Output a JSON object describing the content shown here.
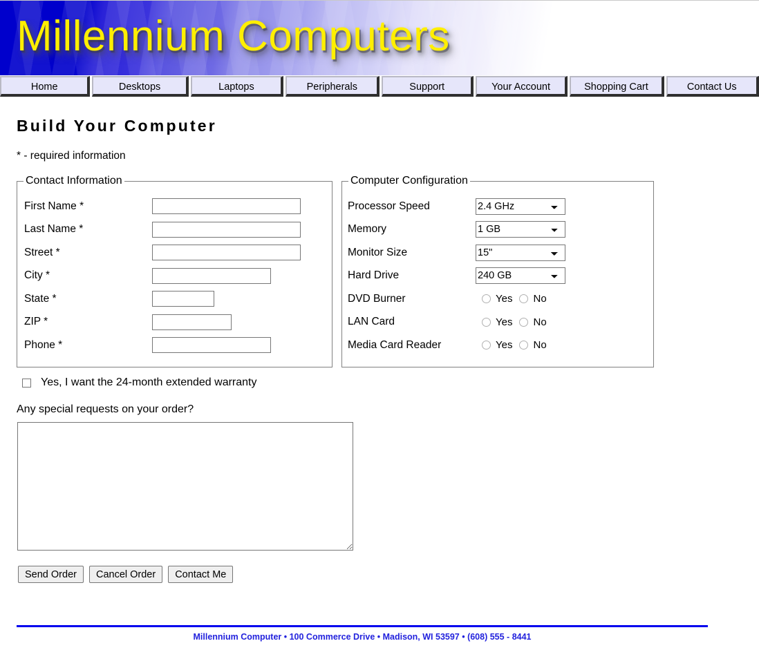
{
  "site": {
    "banner_title": "Millennium Computers"
  },
  "nav": {
    "items": [
      {
        "label": "Home"
      },
      {
        "label": "Desktops"
      },
      {
        "label": "Laptops"
      },
      {
        "label": "Peripherals"
      },
      {
        "label": "Support"
      },
      {
        "label": "Your Account"
      },
      {
        "label": "Shopping Cart"
      },
      {
        "label": "Contact Us"
      }
    ]
  },
  "page": {
    "title": "Build Your Computer",
    "required_note": "* - required information"
  },
  "contact": {
    "legend": "Contact Information",
    "fields": [
      {
        "label": "First Name *",
        "value": "",
        "placeholder": ""
      },
      {
        "label": "Last Name *",
        "value": "",
        "placeholder": ""
      },
      {
        "label": "Street *",
        "value": "",
        "placeholder": ""
      },
      {
        "label": "City *",
        "value": "",
        "placeholder": ""
      },
      {
        "label": "State *",
        "value": "",
        "placeholder": ""
      },
      {
        "label": "ZIP *",
        "value": "",
        "placeholder": ""
      },
      {
        "label": "Phone *",
        "value": "",
        "placeholder": ""
      }
    ]
  },
  "config": {
    "legend": "Computer Configuration",
    "selects": [
      {
        "label": "Processor Speed",
        "value": "2.4 GHz"
      },
      {
        "label": "Memory",
        "value": "1 GB"
      },
      {
        "label": "Monitor Size",
        "value": "15\""
      },
      {
        "label": "Hard Drive",
        "value": "240 GB"
      }
    ],
    "radios": [
      {
        "label": "DVD Burner",
        "yes": "Yes",
        "no": "No",
        "selected": ""
      },
      {
        "label": "LAN Card",
        "yes": "Yes",
        "no": "No",
        "selected": ""
      },
      {
        "label": "Media Card Reader",
        "yes": "Yes",
        "no": "No",
        "selected": ""
      }
    ]
  },
  "warranty": {
    "label": "Yes, I want the 24-month extended warranty",
    "checked": false
  },
  "requests": {
    "label": "Any special requests on your order?",
    "value": "",
    "placeholder": ""
  },
  "actions": {
    "send": "Send Order",
    "cancel": "Cancel Order",
    "contact": "Contact Me"
  },
  "footer": {
    "text": "Millennium Computer • 100 Commerce Drive • Madison, WI 53597 • (608) 555 - 8441",
    "rule_color": "#0000ee",
    "text_color": "#2222dd"
  },
  "colors": {
    "banner_start": "#0000cc",
    "banner_end": "#ffffff",
    "banner_title": "#ffef00",
    "nav_button_face": "#e6e6fa",
    "nav_button_shadow": "#2f2f2f"
  }
}
